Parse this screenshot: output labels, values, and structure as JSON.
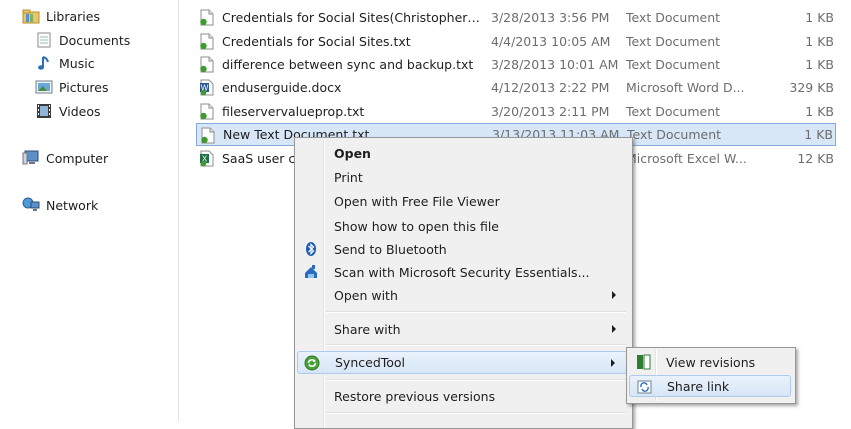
{
  "nav": {
    "libraries": "Libraries",
    "documents": "Documents",
    "music": "Music",
    "pictures": "Pictures",
    "videos": "Videos",
    "computer": "Computer",
    "network": "Network"
  },
  "files": [
    {
      "name": "Credentials for Social Sites(Christopher c...",
      "date": "3/28/2013 3:56 PM",
      "type": "Text Document",
      "size": "1 KB",
      "icon": "text-file-icon"
    },
    {
      "name": "Credentials for Social Sites.txt",
      "date": "4/4/2013 10:05 AM",
      "type": "Text Document",
      "size": "1 KB",
      "icon": "text-file-icon"
    },
    {
      "name": "difference between sync and backup.txt",
      "date": "3/28/2013 10:01 AM",
      "type": "Text Document",
      "size": "1 KB",
      "icon": "text-file-icon"
    },
    {
      "name": "enduserguide.docx",
      "date": "4/12/2013 2:22 PM",
      "type": "Microsoft Word D...",
      "size": "329 KB",
      "icon": "word-file-icon"
    },
    {
      "name": "fileservervalueprop.txt",
      "date": "3/20/2013 2:11 PM",
      "type": "Text Document",
      "size": "1 KB",
      "icon": "text-file-icon"
    },
    {
      "name": "New Text Document.txt",
      "date": "3/13/2013 11:03 AM",
      "type": "Text Document",
      "size": "1 KB",
      "icon": "text-file-icon"
    },
    {
      "name": "SaaS user co",
      "date": "",
      "type": "Microsoft Excel W...",
      "size": "12 KB",
      "icon": "excel-file-icon"
    }
  ],
  "menu": {
    "open": "Open",
    "print": "Print",
    "open_free_viewer": "Open with Free File Viewer",
    "show_how": "Show how to open this file",
    "bluetooth": "Send to Bluetooth",
    "scan": "Scan with Microsoft Security Essentials...",
    "open_with": "Open with",
    "share_with": "Share with",
    "syncedtool": "SyncedTool",
    "restore": "Restore previous versions"
  },
  "submenu": {
    "view_revisions": "View revisions",
    "share_link": "Share link"
  },
  "colors": {
    "selection_bg": "#d7e7f8",
    "selection_border": "#84acdd",
    "menu_bg": "#f0f0f0",
    "accent_green": "#3f9a2f"
  }
}
